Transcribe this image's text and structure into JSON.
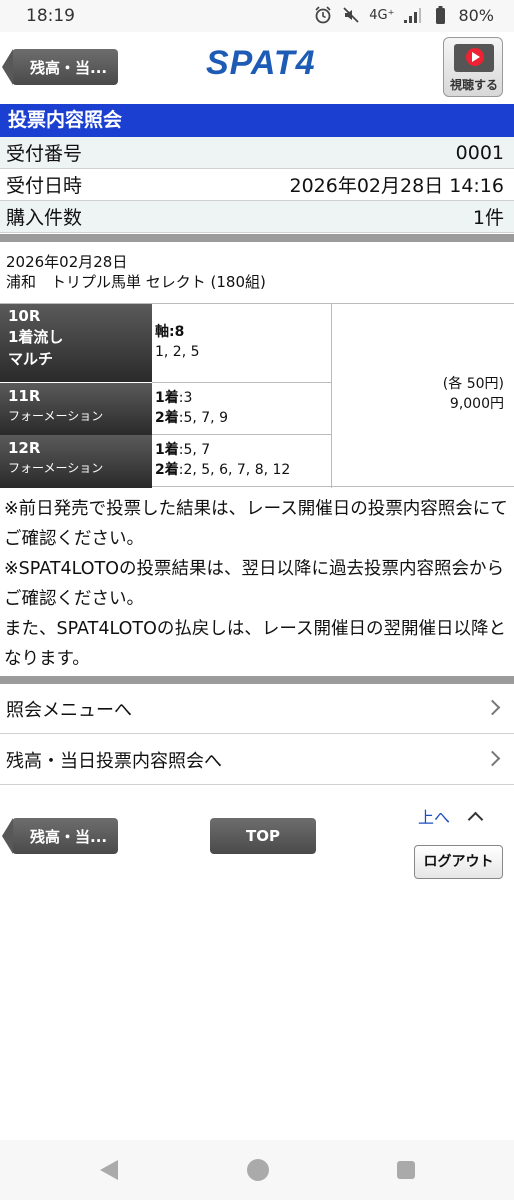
{
  "status_bar": {
    "time": "18:19",
    "network": "4G⁺",
    "battery": "80%",
    "icons": [
      "alarm-icon",
      "mute-icon",
      "signal-icon",
      "battery-icon"
    ]
  },
  "header": {
    "back_label": "残高・当...",
    "logo": "SPAT4",
    "watch_label": "視聴する"
  },
  "title": "投票内容照会",
  "info": {
    "receipt_no_label": "受付番号",
    "receipt_no_value": "0001",
    "receipt_time_label": "受付日時",
    "receipt_time_value": "2026年02月28日 14:16",
    "count_label": "購入件数",
    "count_value": "1件"
  },
  "bet": {
    "date": "2026年02月28日",
    "description": "浦和　トリプル馬単 セレクト (180組)",
    "races": [
      {
        "race": "10R",
        "type_lines": [
          "1着流し",
          "マルチ"
        ],
        "selection": [
          {
            "label": "軸:8",
            "value": ""
          },
          {
            "label": "",
            "value": "1, 2, 5"
          }
        ]
      },
      {
        "race": "11R",
        "type_lines": [
          "フォーメーション"
        ],
        "selection": [
          {
            "label": "1着",
            "value": ":3"
          },
          {
            "label": "2着",
            "value": ":5, 7, 9"
          }
        ]
      },
      {
        "race": "12R",
        "type_lines": [
          "フォーメーション"
        ],
        "selection": [
          {
            "label": "1着",
            "value": ":5, 7"
          },
          {
            "label": "2着",
            "value": ":2, 5, 6, 7, 8, 12"
          }
        ]
      }
    ],
    "unit_amount": "(各 50円)",
    "total_amount": "9,000円"
  },
  "notes": [
    "※前日発売で投票した結果は、レース開催日の投票内容照会にてご確認ください。",
    "※SPAT4LOTOの投票結果は、翌日以降に過去投票内容照会からご確認ください。",
    "また、SPAT4LOTOの払戻しは、レース開催日の翌開催日以降となります。"
  ],
  "menu": {
    "inquiry_menu": "照会メニューへ",
    "balance_today": "残高・当日投票内容照会へ"
  },
  "footer": {
    "back_label": "残高・当...",
    "top_label": "TOP",
    "up_label": "上へ",
    "logout_label": "ログアウト"
  },
  "colors": {
    "title_bar": "#1b3fd1",
    "logo": "#1e5bb5",
    "link": "#1f4fbf",
    "row_alt": "#eef4f4"
  }
}
